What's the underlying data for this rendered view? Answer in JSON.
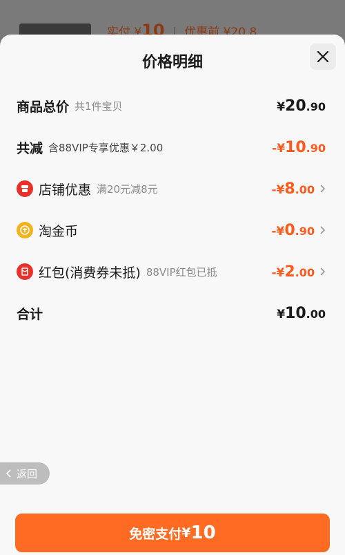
{
  "background": {
    "paid_label": "实付",
    "paid_currency": "¥",
    "paid_amount": "10",
    "before_discount_label": "优惠前",
    "before_discount_amount": "¥20.8"
  },
  "sheet": {
    "title": "价格明细",
    "close_icon": "close-icon"
  },
  "rows": {
    "total": {
      "label": "商品总价",
      "sub": "共1件宝贝",
      "currency": "¥",
      "int": "20",
      "dec": ".90"
    },
    "reduce": {
      "label": "共减",
      "sub": "含88VIP专享优惠￥2.00",
      "prefix": "-¥",
      "int": "10",
      "dec": ".90"
    },
    "shop": {
      "label": "店铺优惠",
      "sub": "满20元减8元",
      "prefix": "-¥",
      "int": "8",
      "dec": ".00"
    },
    "coins": {
      "label": "淘金币",
      "prefix": "-¥",
      "int": "0",
      "dec": ".90"
    },
    "redpacket": {
      "label": "红包(消费券未抵)",
      "sub": "88VIP红包已抵",
      "prefix": "-¥",
      "int": "2",
      "dec": ".00"
    },
    "sum": {
      "label": "合计",
      "currency": "¥",
      "int": "10",
      "dec": ".00"
    }
  },
  "back_button": {
    "label": "返回"
  },
  "pay_button": {
    "label": "免密支付",
    "currency": "¥",
    "amount": "10"
  },
  "colors": {
    "accent": "#ff5a1e",
    "pay_button": "#ff6b22",
    "shop_badge": "#e8312b",
    "coin_badge": "#f6b21e",
    "redpacket_badge": "#e8312b"
  }
}
